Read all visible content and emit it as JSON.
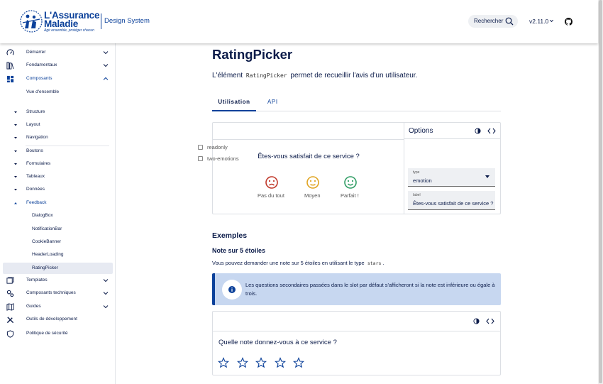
{
  "header": {
    "logo_title_line1": "L'Assurance",
    "logo_title_line2": "Maladie",
    "logo_tagline": "Agir ensemble, protéger chacun",
    "brand": "Design System",
    "search_label": "Rechercher",
    "version": "v2.11.0"
  },
  "sidebar": {
    "items": [
      {
        "label": "Démarrer",
        "icon": "gauge-icon"
      },
      {
        "label": "Fondamentaux",
        "icon": "library-icon"
      },
      {
        "label": "Composants",
        "icon": "components-icon"
      },
      {
        "label": "Vue d'ensemble"
      },
      {
        "label": "Structure"
      },
      {
        "label": "Layout"
      },
      {
        "label": "Navigation"
      },
      {
        "label": "Boutons"
      },
      {
        "label": "Formulaires"
      },
      {
        "label": "Tableaux"
      },
      {
        "label": "Données"
      },
      {
        "label": "Feedback"
      },
      {
        "label": "DialogBox"
      },
      {
        "label": "NotificationBar"
      },
      {
        "label": "CookieBanner"
      },
      {
        "label": "HeaderLoading"
      },
      {
        "label": "RatingPicker"
      },
      {
        "label": "Templates",
        "icon": "templates-icon"
      },
      {
        "label": "Composants techniques",
        "icon": "cogs-icon"
      },
      {
        "label": "Guides",
        "icon": "map-icon"
      },
      {
        "label": "Outils de développement",
        "icon": "tools-icon"
      },
      {
        "label": "Politique de sécurité",
        "icon": "shield-icon"
      }
    ]
  },
  "main": {
    "title": "RatingPicker",
    "intro_before": "L'élément",
    "intro_code": "RatingPicker",
    "intro_after": "permet de recueillir l'avis d'un utilisateur.",
    "tabs": [
      {
        "label": "Utilisation"
      },
      {
        "label": "API"
      }
    ],
    "demo": {
      "question": "Êtes-vous satisfait de ce service ?",
      "emotions": [
        {
          "label": "Pas du tout",
          "color": "#c0392b"
        },
        {
          "label": "Moyen",
          "color": "#e0a422"
        },
        {
          "label": "Parfait !",
          "color": "#2e9c63"
        }
      ],
      "options_title": "Options",
      "options": [
        {
          "label": "readonly"
        },
        {
          "label": "two-emotions"
        }
      ],
      "type_label": "type",
      "type_value": "emotion",
      "label_label": "label",
      "label_value": "Êtes-vous satisfait de ce service ?"
    },
    "examples_title": "Exemples",
    "example1_title": "Note sur 5 étoiles",
    "example1_text_before": "Vous pouvez demander une note sur 5 étoiles en utilisant le type",
    "example1_code": "stars",
    "example1_text_after": ".",
    "alert_text": "Les questions secondaires passées dans le slot par défaut s'afficheront si la note est inférieure ou égale à trois.",
    "demo2_question": "Quelle note donnez-vous à ce service ?"
  },
  "colors": {
    "primary": "#0c419a",
    "text": "#0c1c4a",
    "alert_bg": "#c7d7f0"
  }
}
